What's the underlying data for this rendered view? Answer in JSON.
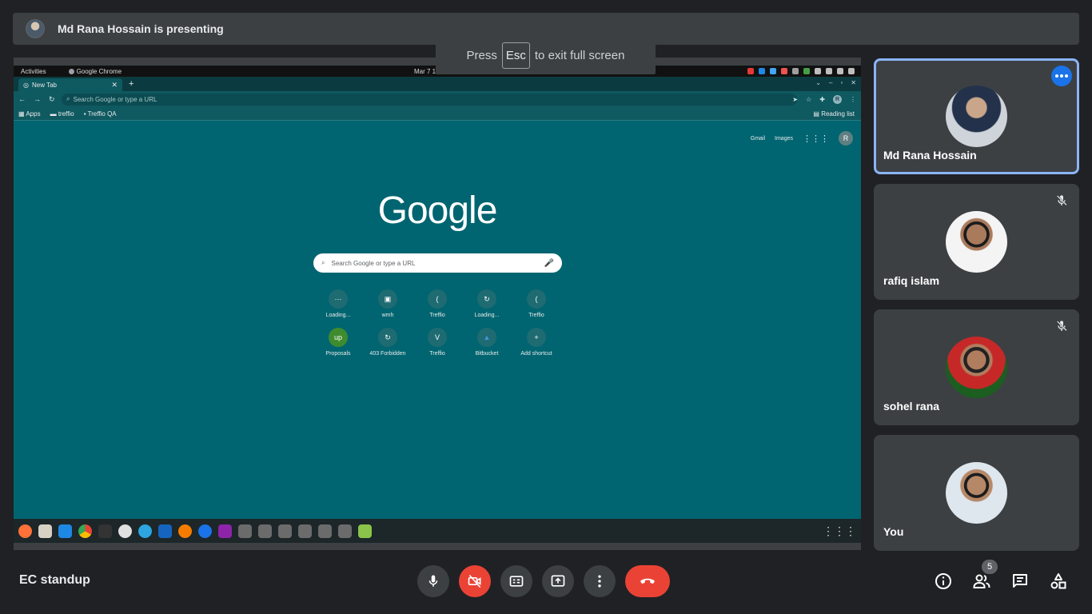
{
  "meeting": {
    "presenting_text": "Md Rana Hossain is presenting",
    "title": "EC standup",
    "participant_count": "5"
  },
  "fullscreen_hint": {
    "before": "Press",
    "key": "Esc",
    "after": "to exit full screen"
  },
  "shared_screen": {
    "os_bar": {
      "activities": "Activities",
      "app": "Google Chrome",
      "clock": "Mar 7  12:50 PM"
    },
    "tab_title": "New Tab",
    "omnibox_placeholder": "Search Google or type a URL",
    "bookmarks": [
      "Apps",
      "treffio",
      "Treffio QA"
    ],
    "reading_list": "Reading list",
    "google_links": [
      "Gmail",
      "Images"
    ],
    "profile_initial": "R",
    "logo": "Google",
    "search_placeholder": "Search Google or type a URL",
    "shortcuts": [
      "Loading...",
      "wmh",
      "Treffio",
      "Loading...",
      "Treffio",
      "Proposals",
      "403 Forbidden",
      "Treffio",
      "Bitbucket",
      "Add shortcut"
    ]
  },
  "participants": [
    {
      "name": "Md Rana Hossain",
      "active": true,
      "muted": false
    },
    {
      "name": "rafiq islam",
      "active": false,
      "muted": true
    },
    {
      "name": "sohel rana",
      "active": false,
      "muted": true
    },
    {
      "name": "You",
      "active": false,
      "muted": false
    }
  ],
  "controls": [
    "microphone",
    "camera-off",
    "captions",
    "present-screen",
    "more-options",
    "leave-call"
  ],
  "right_controls": [
    "meeting-details",
    "people",
    "chat",
    "activities"
  ],
  "colors": {
    "background": "#202124",
    "panel": "#3c4043",
    "accent": "#1a73e8",
    "danger": "#ea4335",
    "active_border": "#8ab4f8",
    "shared_bg": "#006570"
  }
}
